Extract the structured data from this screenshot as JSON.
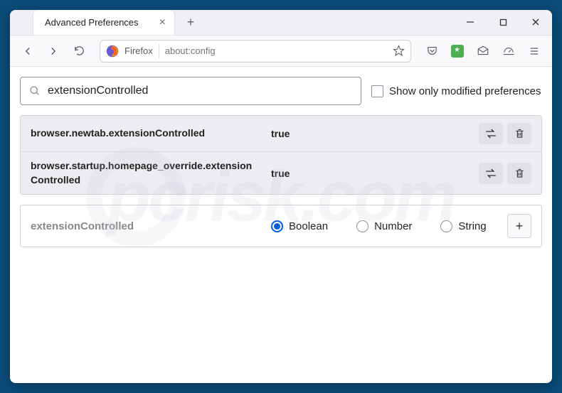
{
  "tab": {
    "title": "Advanced Preferences"
  },
  "urlbar": {
    "brand": "Firefox",
    "url": "about:config"
  },
  "search": {
    "value": "extensionControlled",
    "checkbox_label": "Show only modified preferences"
  },
  "prefs": [
    {
      "name": "browser.newtab.extensionControlled",
      "value": "true"
    },
    {
      "name": "browser.startup.homepage_override.extensionControlled",
      "value": "true"
    }
  ],
  "newpref": {
    "name": "extensionControlled",
    "types": [
      "Boolean",
      "Number",
      "String"
    ],
    "selected": 0
  },
  "watermark": "pcrisk.com"
}
